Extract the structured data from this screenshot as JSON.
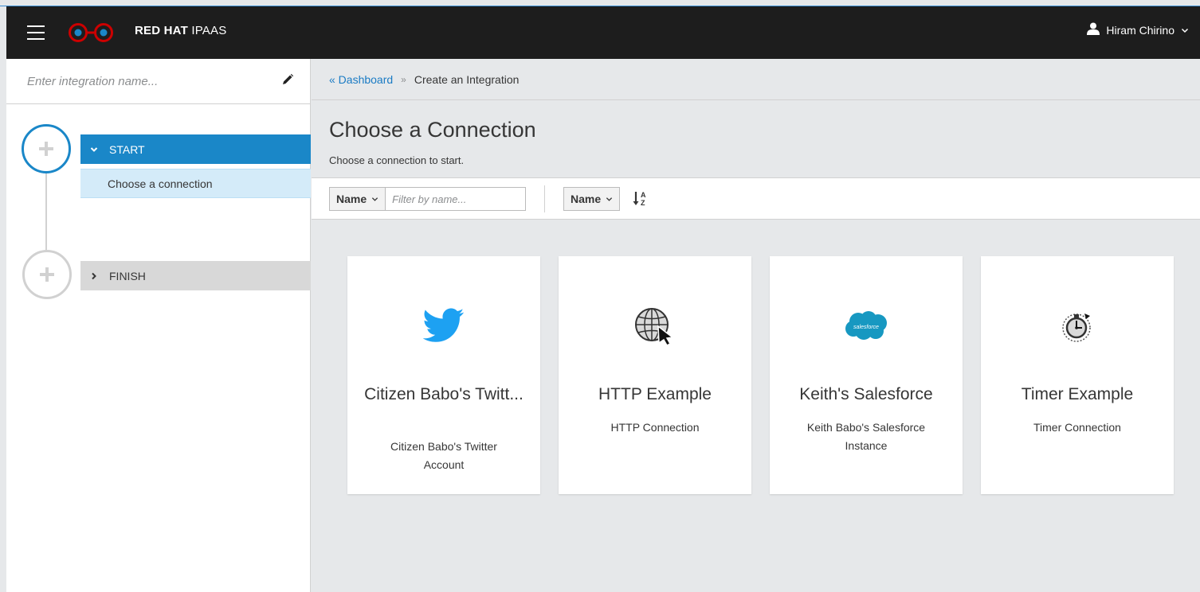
{
  "navbar": {
    "brand_bold": "RED HAT",
    "brand_light": "IPAAS",
    "user_name": "Hiram Chirino",
    "icons": {
      "menu": "hamburger-icon",
      "user": "user-icon",
      "dropdown": "chevron-down-icon"
    }
  },
  "sidebar": {
    "name_placeholder": "Enter integration name...",
    "steps": [
      {
        "label": "START",
        "sub_label": "Choose a connection",
        "state": "active"
      },
      {
        "label": "FINISH",
        "state": "inactive"
      }
    ]
  },
  "breadcrumb": {
    "back_link": "« Dashboard",
    "separator": "»",
    "current": "Create an Integration"
  },
  "main": {
    "title": "Choose a Connection",
    "description": "Choose a connection to start."
  },
  "toolbar": {
    "filter_field": "Name",
    "filter_placeholder": "Filter by name...",
    "sort_field": "Name",
    "sort_icon": "sort-alpha-asc-icon"
  },
  "connections": [
    {
      "title": "Citizen Babo's Twitt...",
      "description": "Citizen Babo's Twitter Account",
      "icon": "twitter-icon"
    },
    {
      "title": "HTTP Example",
      "description": "HTTP Connection",
      "icon": "globe-cursor-icon"
    },
    {
      "title": "Keith's Salesforce",
      "description": "Keith Babo's Salesforce Instance",
      "icon": "salesforce-icon",
      "icon_text": "salesforce"
    },
    {
      "title": "Timer Example",
      "description": "Timer Connection",
      "icon": "stopwatch-icon"
    }
  ],
  "colors": {
    "accent": "#1a87c8",
    "navbar_bg": "#1d1d1d",
    "brand_red": "#cc0000",
    "page_bg": "#e6e8ea",
    "twitter_blue": "#1da1f2",
    "salesforce_blue": "#1798c1"
  }
}
